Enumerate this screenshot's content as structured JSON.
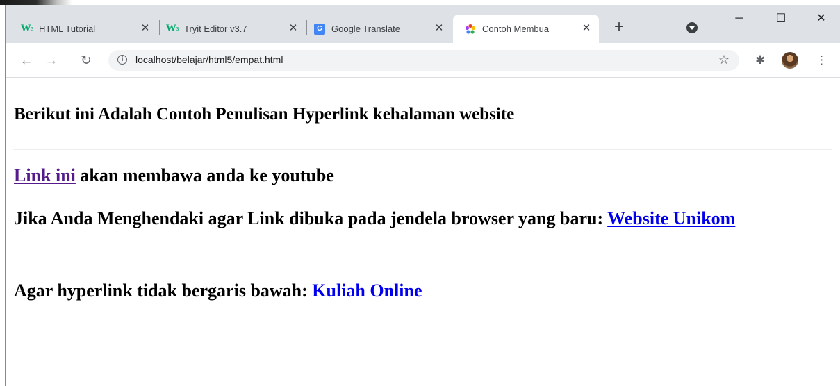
{
  "tabs": [
    {
      "label": "HTML Tutorial",
      "favicon": "w3schools-icon",
      "active": false
    },
    {
      "label": "Tryit Editor v3.7",
      "favicon": "w3schools-icon",
      "active": false
    },
    {
      "label": "Google Translate",
      "favicon": "google-translate-icon",
      "active": false
    },
    {
      "label": "Contoh Membua",
      "favicon": "colorful-flower-icon",
      "active": true
    }
  ],
  "tab_close_glyph": "✕",
  "new_tab_glyph": "+",
  "window_controls": {
    "minimize": "─",
    "maximize": "☐",
    "close": "✕"
  },
  "toolbar": {
    "back": "←",
    "forward": "→",
    "reload": "↻",
    "info": "i",
    "url": "localhost/belajar/html5/empat.html",
    "bookmark": "☆",
    "extensions": "✱",
    "menu": "⋮"
  },
  "page": {
    "heading": "Berikut ini Adalah Contoh Penulisan Hyperlink kehalaman website",
    "p1_link": "Link ini",
    "p1_text": " akan membawa anda ke youtube",
    "p2_text": "Jika Anda Menghendaki agar Link dibuka pada jendela browser yang baru: ",
    "p2_link": "Website Unikom",
    "p3_text": "Agar hyperlink tidak bergaris bawah: ",
    "p3_link": "Kuliah Online"
  },
  "colors": {
    "link": "#0000ee",
    "visited_link": "#551a8b",
    "tabstrip": "#dee1e6",
    "omnibox": "#f1f3f4"
  }
}
